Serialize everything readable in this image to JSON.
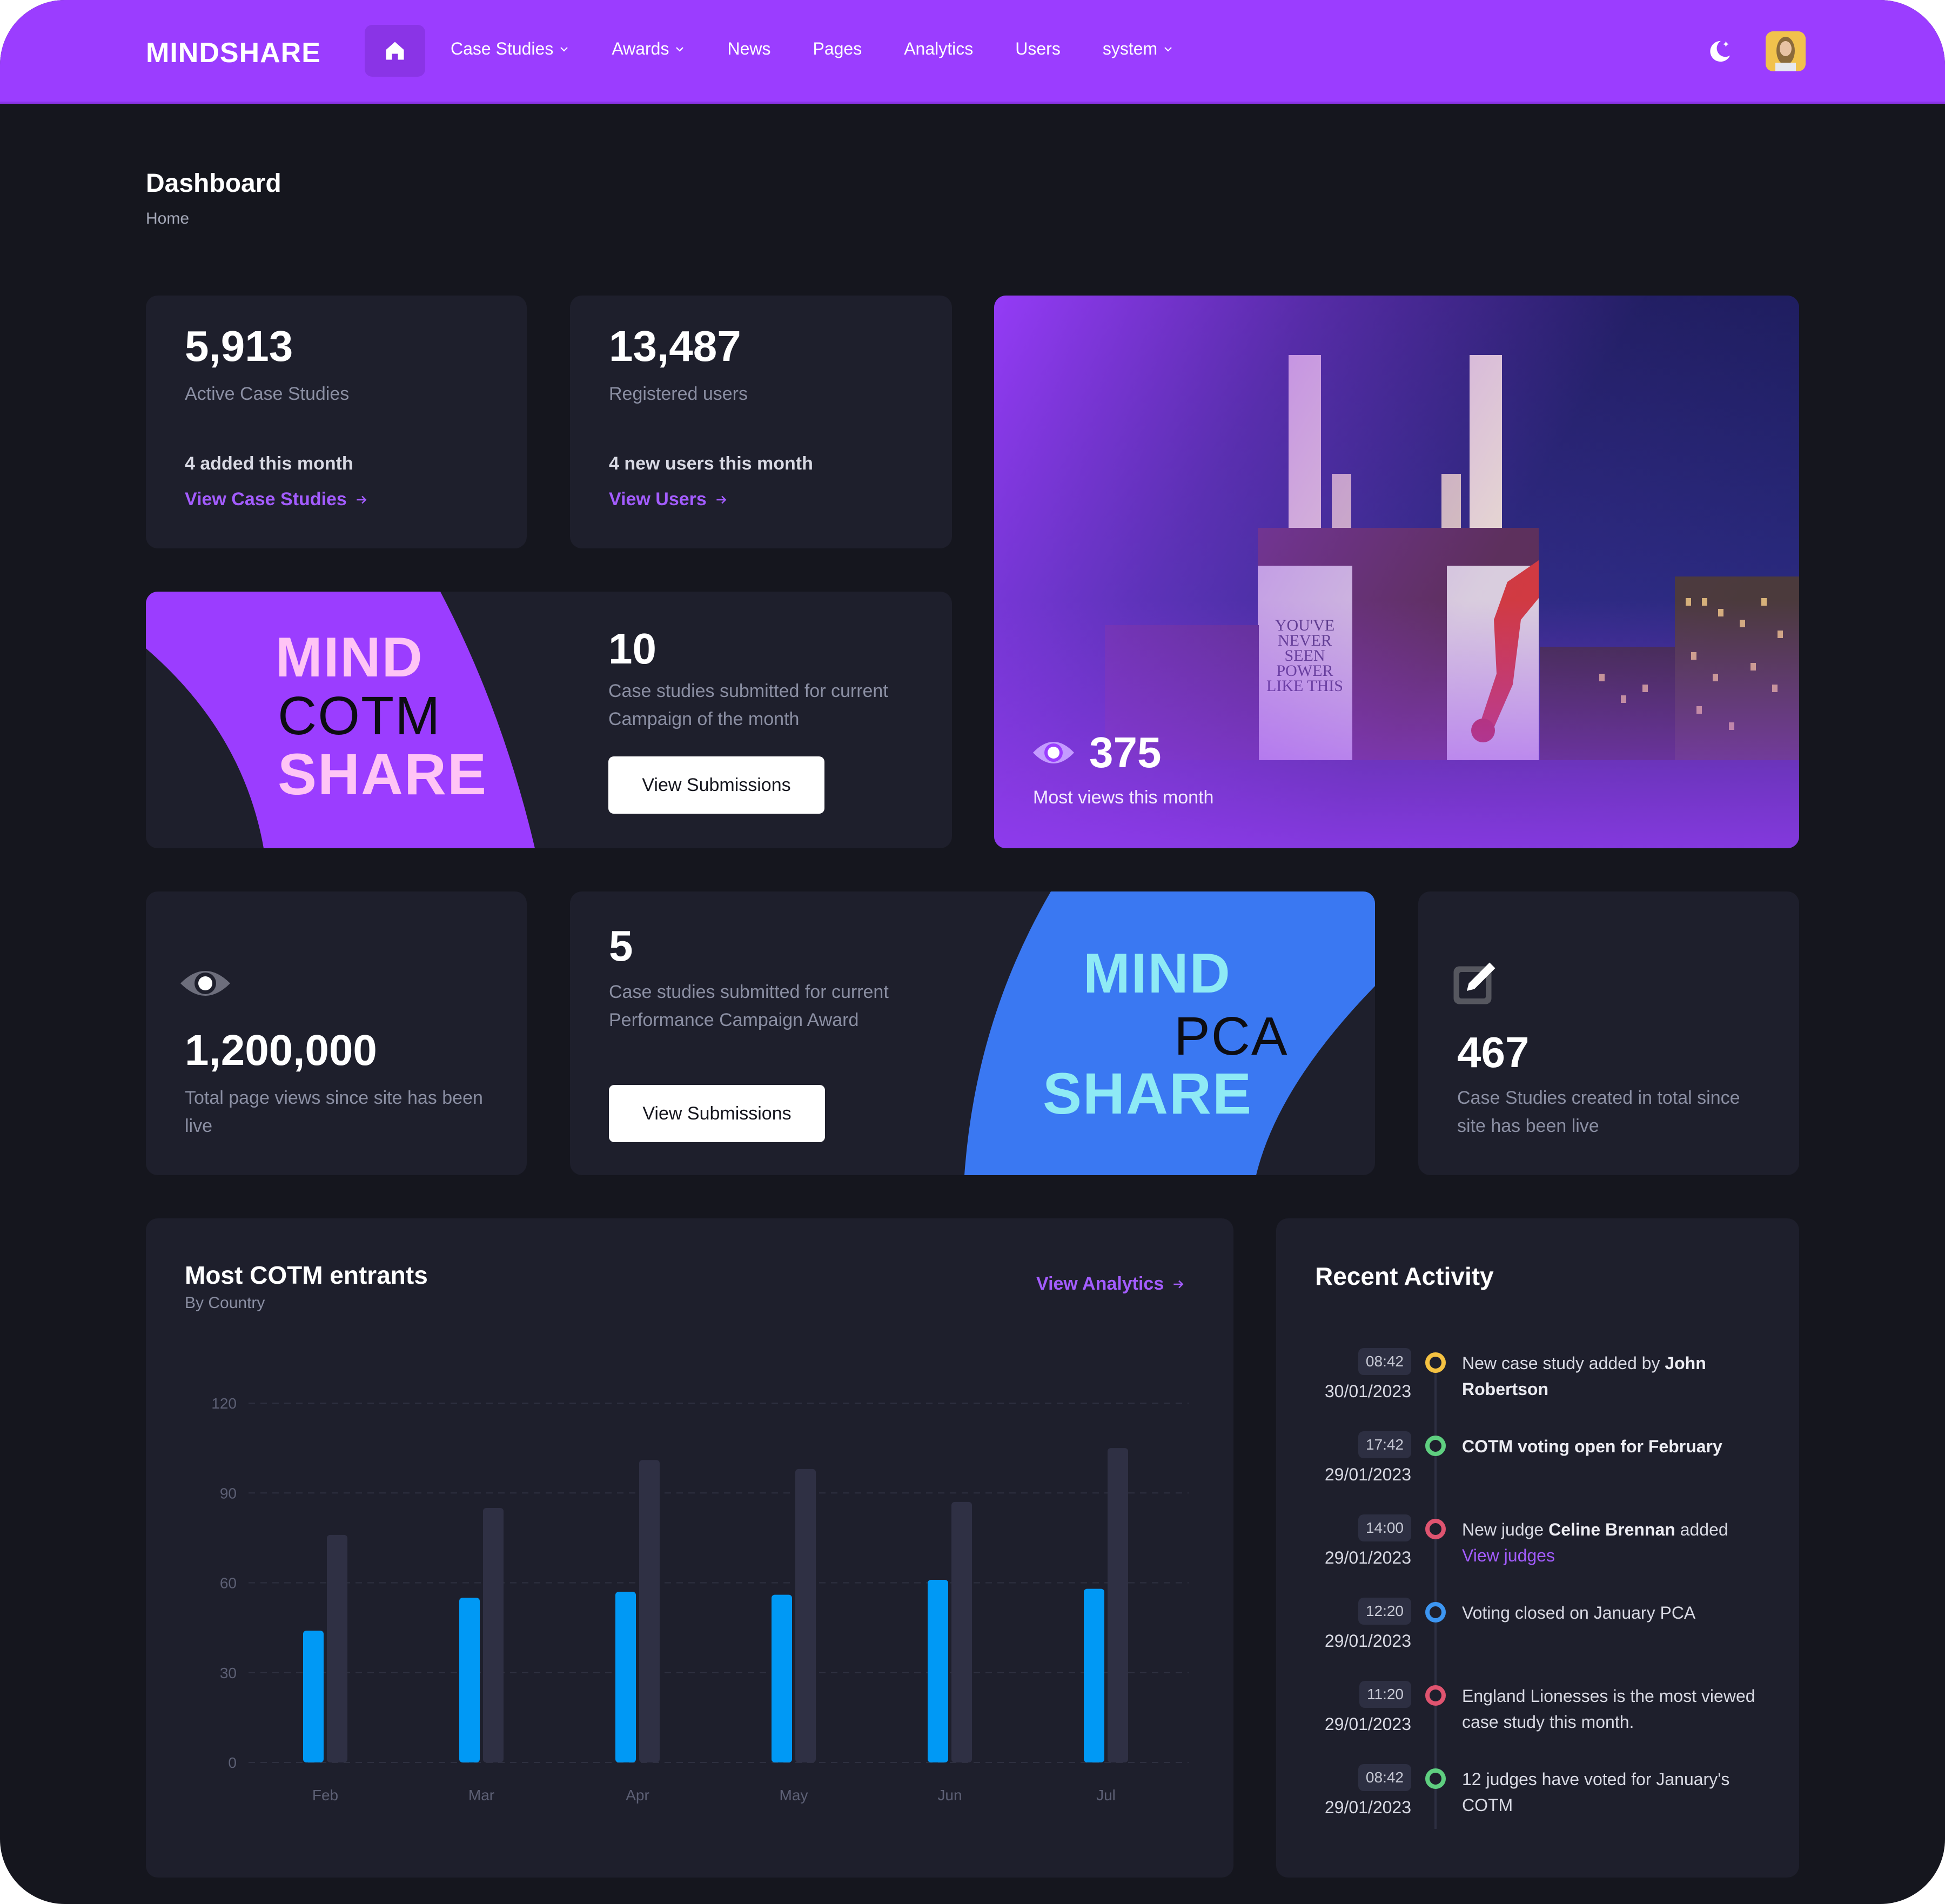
{
  "navbar": {
    "logo": "MINDSHARE",
    "items": [
      {
        "label": "Case Studies",
        "dropdown": true
      },
      {
        "label": "Awards",
        "dropdown": true
      },
      {
        "label": "News",
        "dropdown": false
      },
      {
        "label": "Pages",
        "dropdown": false
      },
      {
        "label": "Analytics",
        "dropdown": false
      },
      {
        "label": "Users",
        "dropdown": false
      },
      {
        "label": "system",
        "dropdown": true
      }
    ],
    "icons": {
      "home": "home-icon",
      "theme": "moon-icon",
      "avatar": "user-avatar"
    }
  },
  "page": {
    "title": "Dashboard",
    "breadcrumb": "Home"
  },
  "stats": {
    "case_studies": {
      "value": "5,913",
      "label": "Active Case Studies",
      "note": "4 added this month",
      "link": "View Case Studies"
    },
    "users": {
      "value": "13,487",
      "label": "Registered users",
      "note": "4 new users this month",
      "link": "View Users"
    },
    "cotm": {
      "brand_top": "MIND",
      "brand_mid": "COTM",
      "brand_bottom": "SHARE",
      "value": "10",
      "label": "Case studies submitted for current Campaign of the month",
      "button": "View Submissions"
    },
    "most_views": {
      "value": "375",
      "label": "Most views this month",
      "image_alt": "Battersea Power Station with 'You've never seen power like this' projection"
    },
    "page_views": {
      "value": "1,200,000",
      "label": "Total page views since site has been live"
    },
    "pca": {
      "brand_top": "MIND",
      "brand_mid": "PCA",
      "brand_bottom": "SHARE",
      "value": "5",
      "label": "Case studies submitted for current Performance Campaign Award",
      "button": "View Submissions"
    },
    "total_created": {
      "value": "467",
      "label": "Case Studies created in total since site has been live"
    }
  },
  "colors": {
    "brand_purple": "#9b3dff",
    "link_purple": "#a35cff",
    "cotm_pink": "#ffc4f5",
    "pca_blue": "#3a78f2",
    "pca_cyan": "#8eeaf5",
    "bar_primary": "#0099f5",
    "bar_secondary": "#2f3044"
  },
  "chart_card": {
    "title": "Most COTM entrants",
    "subtitle": "By Country",
    "link": "View Analytics"
  },
  "chart_data": {
    "type": "bar",
    "title": "Most COTM entrants",
    "subtitle": "By Country",
    "categories": [
      "Feb",
      "Mar",
      "Apr",
      "May",
      "Jun",
      "Jul"
    ],
    "series": [
      {
        "name": "Series 1",
        "color": "#0099f5",
        "values": [
          44,
          55,
          57,
          56,
          61,
          58
        ]
      },
      {
        "name": "Series 2",
        "color": "#2f3044",
        "values": [
          76,
          85,
          101,
          98,
          87,
          105
        ]
      }
    ],
    "yticks": [
      0,
      30,
      60,
      90,
      120
    ],
    "ylim": [
      0,
      120
    ],
    "grid": true,
    "legend": "none",
    "xlabel": "",
    "ylabel": ""
  },
  "activity": {
    "title": "Recent Activity",
    "items": [
      {
        "time": "08:42",
        "date": "30/01/2023",
        "color": "#f5c242",
        "pre": "New case study added by ",
        "bold": "John Robertson",
        "post": "",
        "link": ""
      },
      {
        "time": "17:42",
        "date": "29/01/2023",
        "color": "#5fcf80",
        "pre": "",
        "bold": "COTM voting open for February",
        "post": "",
        "link": ""
      },
      {
        "time": "14:00",
        "date": "29/01/2023",
        "color": "#e05470",
        "pre": "New judge ",
        "bold": "Celine Brennan",
        "post": " added",
        "link": "View judges"
      },
      {
        "time": "12:20",
        "date": "29/01/2023",
        "color": "#3d96f2",
        "pre": "Voting closed on January PCA",
        "bold": "",
        "post": "",
        "link": ""
      },
      {
        "time": "11:20",
        "date": "29/01/2023",
        "color": "#e05470",
        "pre": "England Lionesses is the most viewed case study this month.",
        "bold": "",
        "post": "",
        "link": ""
      },
      {
        "time": "08:42",
        "date": "29/01/2023",
        "color": "#5fcf80",
        "pre": "12 judges have voted for January's COTM",
        "bold": "",
        "post": "",
        "link": ""
      }
    ]
  }
}
